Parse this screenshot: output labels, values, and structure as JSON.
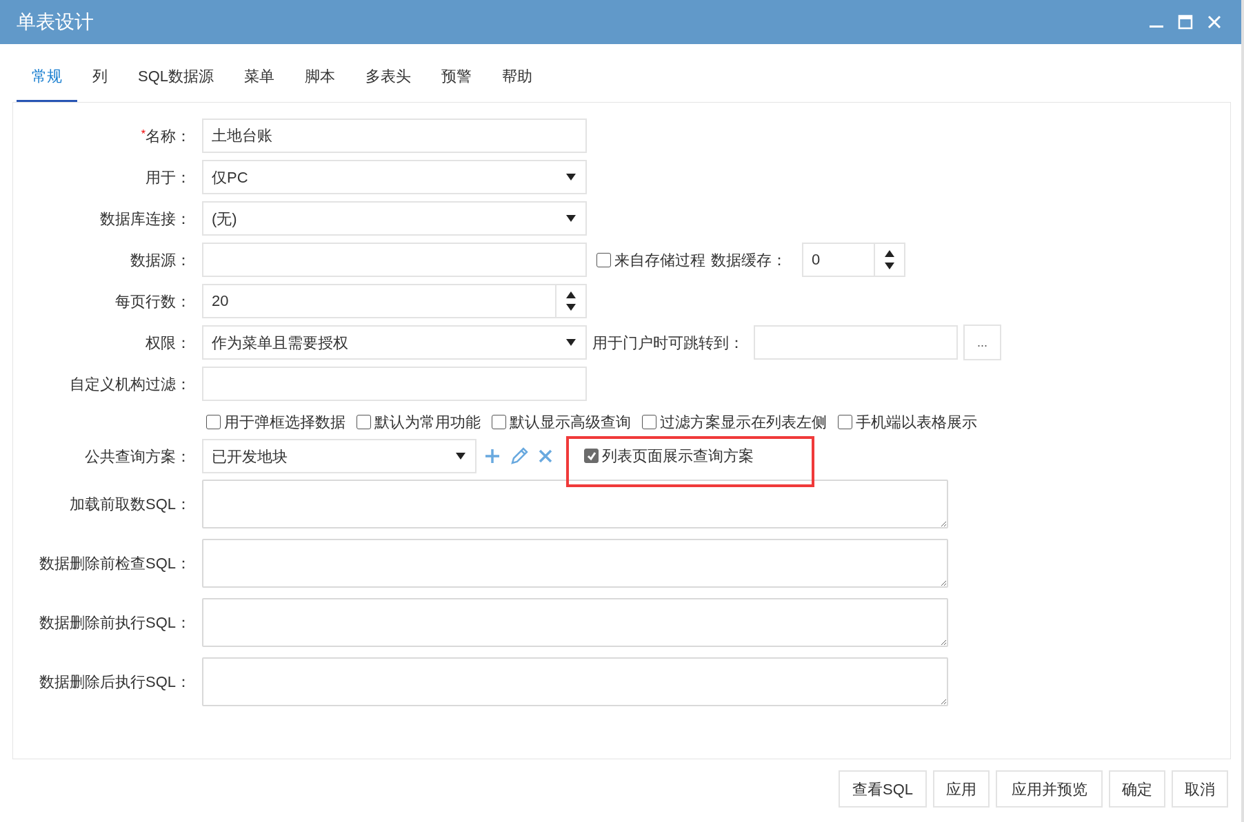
{
  "window": {
    "title": "单表设计"
  },
  "tabs": [
    {
      "label": "常规",
      "selected": true
    },
    {
      "label": "列",
      "selected": false
    },
    {
      "label": "SQL数据源",
      "selected": false
    },
    {
      "label": "菜单",
      "selected": false
    },
    {
      "label": "脚本",
      "selected": false
    },
    {
      "label": "多表头",
      "selected": false
    },
    {
      "label": "预警",
      "selected": false
    },
    {
      "label": "帮助",
      "selected": false
    }
  ],
  "rows": [
    {
      "kind": "text",
      "required_mark": "*",
      "label": "名称：",
      "value": "土地台账"
    },
    {
      "kind": "select",
      "label": "用于：",
      "value": "仅PC"
    },
    {
      "kind": "select",
      "label": "数据库连接：",
      "value": "(无)"
    },
    {
      "kind": "text",
      "label": "数据源：",
      "extras": [
        {
          "kind": "checkbox",
          "label": "来自存储过程",
          "checked": false
        },
        {
          "kind": "label",
          "label": "数据缓存："
        },
        {
          "kind": "spinner",
          "value": "0"
        }
      ]
    },
    {
      "kind": "spinner",
      "label": "每页行数：",
      "value": "20"
    },
    {
      "kind": "select",
      "label": "权限：",
      "value": "作为菜单且需要授权",
      "extras": [
        {
          "kind": "label",
          "label": "用于门户时可跳转到："
        },
        {
          "kind": "text"
        },
        {
          "kind": "button",
          "label": "..."
        }
      ]
    },
    {
      "kind": "text",
      "label": "自定义机构过滤："
    }
  ],
  "options": [
    {
      "label": "用于弹框选择数据",
      "checked": false
    },
    {
      "label": "默认为常用功能",
      "checked": false
    },
    {
      "label": "默认显示高级查询",
      "checked": false
    },
    {
      "label": "过滤方案显示在列表左侧",
      "checked": false
    },
    {
      "label": "手机端以表格展示",
      "checked": false
    }
  ],
  "query_scheme": {
    "label": "公共查询方案：",
    "value": "已开发地块",
    "show_option": {
      "label": "列表页面展示查询方案",
      "checked": true
    }
  },
  "sql_fields": [
    {
      "label": "加载前取数SQL："
    },
    {
      "label": "数据删除前检查SQL："
    },
    {
      "label": "数据删除前执行SQL："
    },
    {
      "label": "数据删除后执行SQL："
    }
  ],
  "buttons": [
    "查看SQL",
    "应用",
    "应用并预览",
    "确定",
    "取消"
  ]
}
